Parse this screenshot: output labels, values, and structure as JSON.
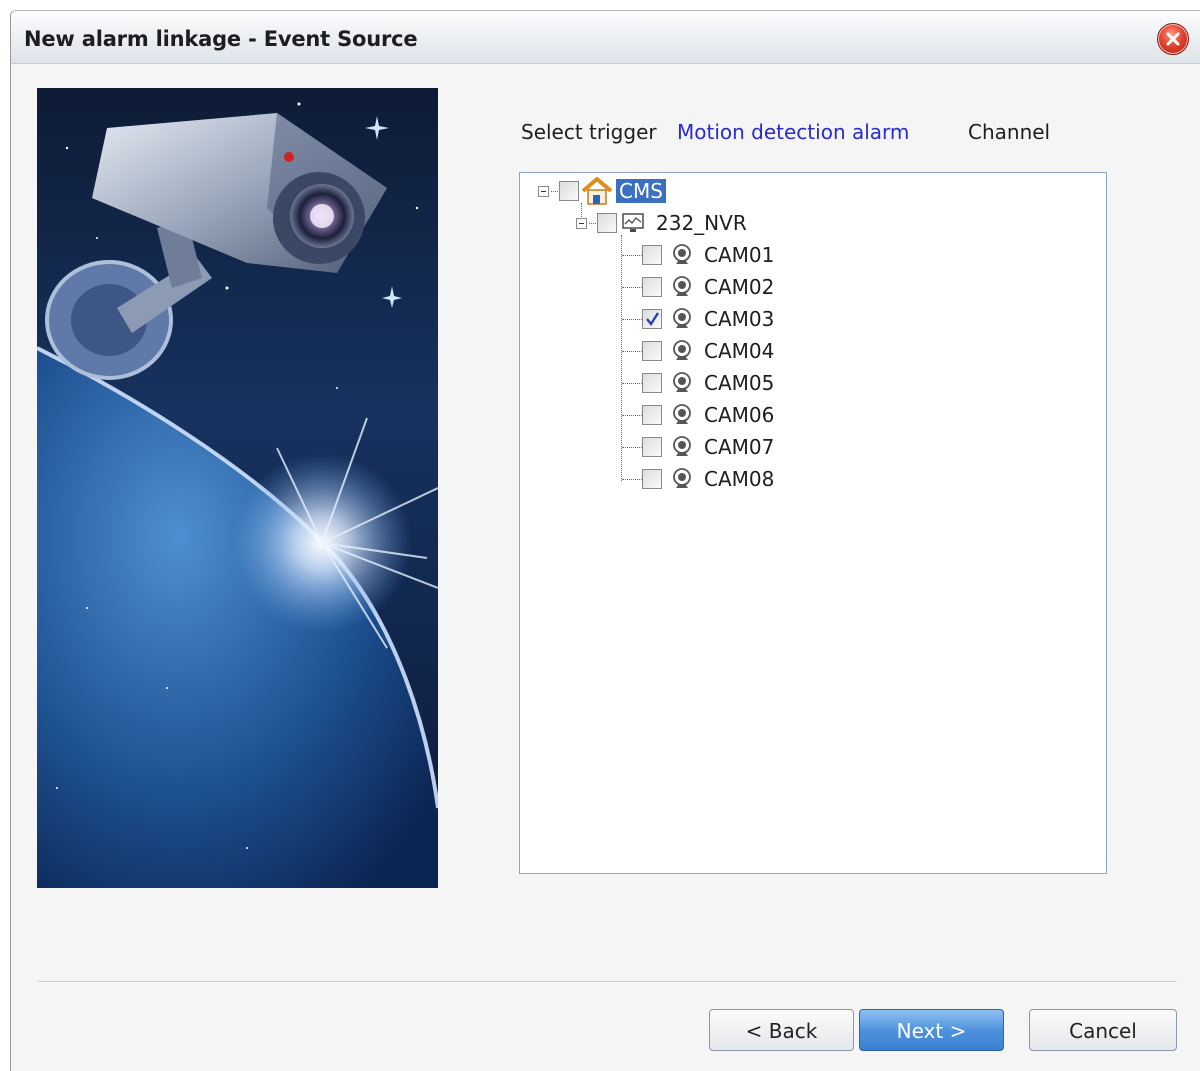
{
  "window": {
    "title": "New alarm linkage  -  Event Source"
  },
  "trigger": {
    "label": "Select trigger",
    "value": "Motion detection alarm",
    "channel_label": "Channel"
  },
  "tree": {
    "root": {
      "label": "CMS",
      "checked": false,
      "selected": true
    },
    "device": {
      "label": "232_NVR",
      "checked": false
    },
    "cameras": [
      {
        "label": "CAM01",
        "checked": false
      },
      {
        "label": "CAM02",
        "checked": false
      },
      {
        "label": "CAM03",
        "checked": true
      },
      {
        "label": "CAM04",
        "checked": false
      },
      {
        "label": "CAM05",
        "checked": false
      },
      {
        "label": "CAM06",
        "checked": false
      },
      {
        "label": "CAM07",
        "checked": false
      },
      {
        "label": "CAM08",
        "checked": false
      }
    ]
  },
  "buttons": {
    "back": "< Back",
    "next": "Next >",
    "cancel": "Cancel"
  },
  "icons": {
    "close": "close-icon",
    "root": "house-icon",
    "device": "monitor-icon",
    "camera": "webcam-icon"
  },
  "colors": {
    "accent": "#3b6fc2",
    "link": "#2a2ad0",
    "close": "#e0432f"
  }
}
